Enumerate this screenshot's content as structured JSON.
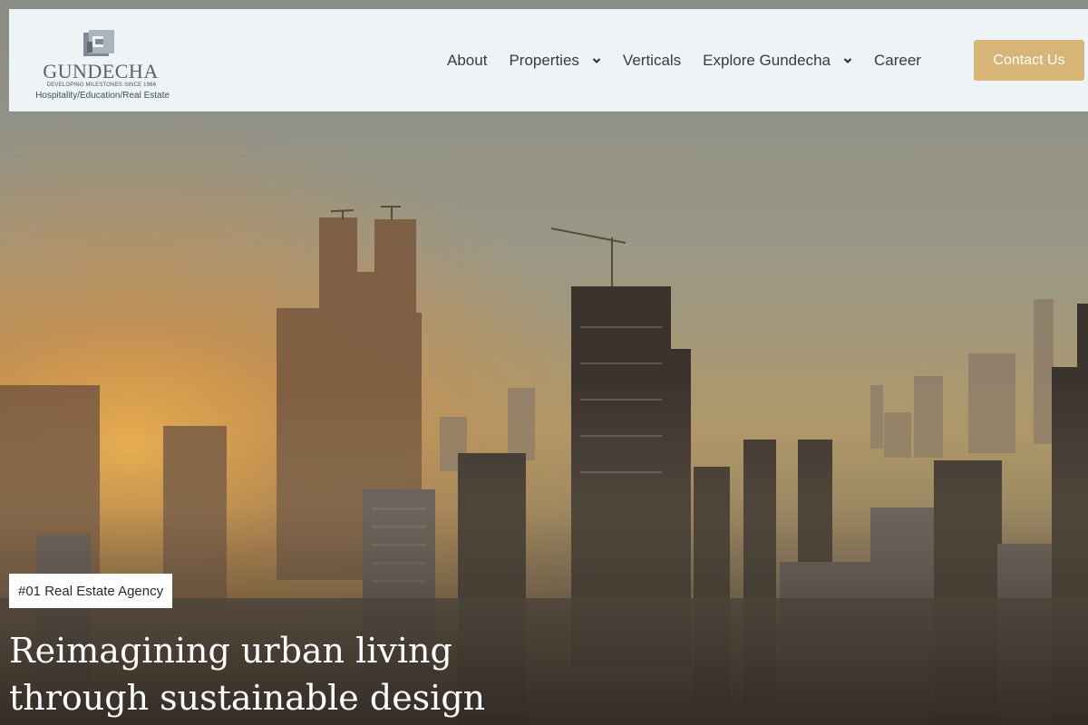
{
  "brand": {
    "name": "GUNDECHA",
    "tagline": "DEVELOPING MILESTONES SINCE 1966",
    "sub": "Hospitality/Education/Real Estate"
  },
  "nav": {
    "items": [
      {
        "label": "About",
        "has_dropdown": false
      },
      {
        "label": "Properties",
        "has_dropdown": true
      },
      {
        "label": "Verticals",
        "has_dropdown": false
      },
      {
        "label": "Explore Gundecha",
        "has_dropdown": true
      },
      {
        "label": "Career",
        "has_dropdown": false
      }
    ],
    "contact_label": "Contact Us"
  },
  "hero": {
    "badge": "#01 Real Estate Agency",
    "headline_line1": "Reimagining urban living",
    "headline_line2": "through sustainable design"
  },
  "colors": {
    "header_bg": "#eef3f6",
    "accent": "#d6b577",
    "nav_text": "#3b3b3b"
  }
}
